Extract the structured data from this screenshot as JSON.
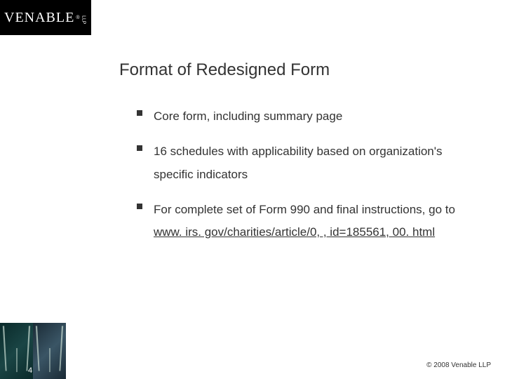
{
  "logo": {
    "brand": "VENABLE",
    "reg": "®",
    "suffix": "LLP"
  },
  "title": "Format of Redesigned Form",
  "bullets": [
    {
      "text": "Core form, including summary page"
    },
    {
      "text": "16 schedules with applicability based on organization's specific indicators"
    },
    {
      "text": "For complete set of Form 990 and final instructions, go to ",
      "link": "www. irs. gov/charities/article/0, , id=185561, 00. html"
    }
  ],
  "page_number": "4",
  "copyright": "© 2008 Venable LLP"
}
